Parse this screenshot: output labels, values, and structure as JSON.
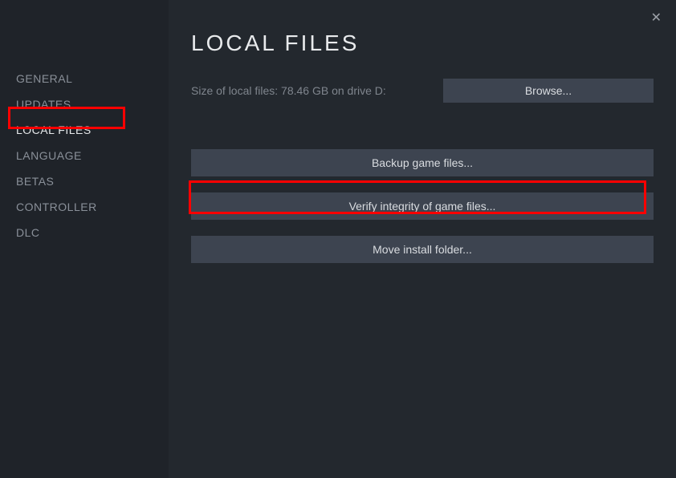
{
  "sidebar": {
    "items": [
      {
        "label": "GENERAL",
        "active": false
      },
      {
        "label": "UPDATES",
        "active": false
      },
      {
        "label": "LOCAL FILES",
        "active": true
      },
      {
        "label": "LANGUAGE",
        "active": false
      },
      {
        "label": "BETAS",
        "active": false
      },
      {
        "label": "CONTROLLER",
        "active": false
      },
      {
        "label": "DLC",
        "active": false
      }
    ]
  },
  "main": {
    "title": "LOCAL FILES",
    "size_text": "Size of local files: 78.46 GB on drive D:",
    "browse_label": "Browse...",
    "buttons": {
      "backup": "Backup game files...",
      "verify": "Verify integrity of game files...",
      "move": "Move install folder..."
    }
  }
}
